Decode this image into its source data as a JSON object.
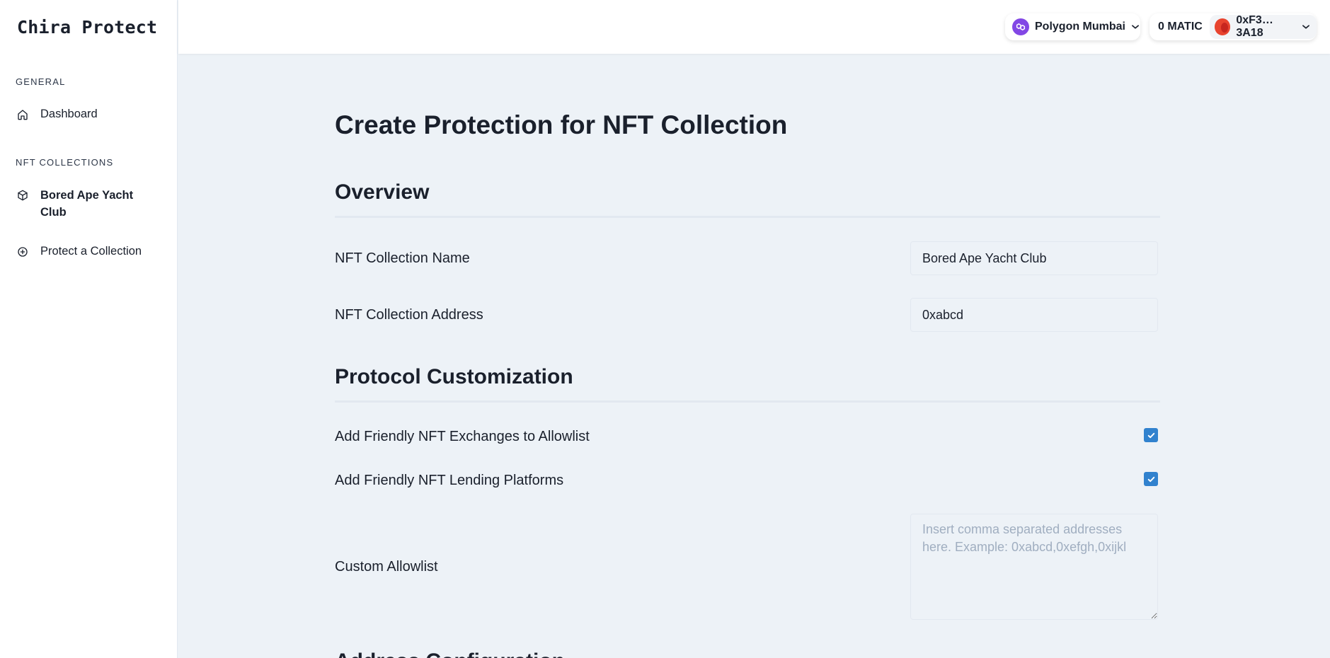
{
  "sidebar": {
    "brand": "Chira Protect",
    "general_label": "GENERAL",
    "dashboard_label": "Dashboard",
    "collections_label": "NFT COLLECTIONS",
    "collections": [
      {
        "label_line1": "Bored Ape Yacht",
        "label_line2": "Club",
        "icon": "cube-icon"
      }
    ],
    "protect_label": "Protect a Collection"
  },
  "topbar": {
    "network_name": "Polygon Mumbai",
    "balance": "0 MATIC",
    "address": "0xF3…3A18",
    "colors": {
      "network_icon": "#8247e5",
      "avatar": "#e8442f"
    }
  },
  "main": {
    "page_title": "Create Protection for NFT Collection",
    "overview_heading": "Overview",
    "collection_name_label": "NFT Collection Name",
    "collection_name_value": "Bored Ape Yacht Club",
    "collection_address_label": "NFT Collection Address",
    "collection_address_value": "0xabcd",
    "protocol_heading": "Protocol Customization",
    "exchanges_label": "Add Friendly NFT Exchanges to Allowlist",
    "exchanges_checked": true,
    "lending_label": "Add Friendly NFT Lending Platforms",
    "lending_checked": true,
    "allowlist_label": "Custom Allowlist",
    "allowlist_value": "",
    "allowlist_placeholder": "Insert comma separated addresses here. Example: 0xabcd,0xefgh,0xijkl",
    "next_heading": "Address Configuration"
  },
  "colors": {
    "accent": "#3182ce",
    "background": "#edf2f7",
    "text": "#1a202c"
  }
}
